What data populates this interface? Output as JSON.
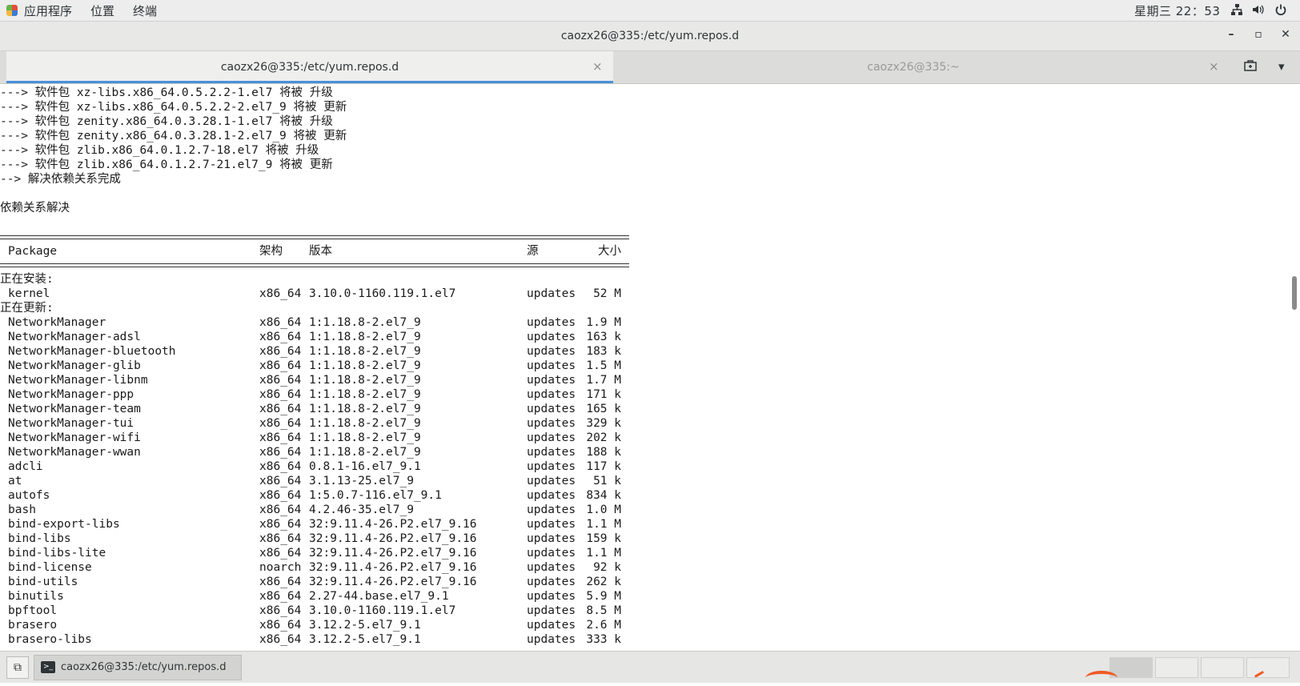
{
  "top_panel": {
    "menus": [
      "应用程序",
      "位置",
      "终端"
    ],
    "clock": "星期三 22：53"
  },
  "window": {
    "title": "caozx26@335:/etc/yum.repos.d"
  },
  "tabs": [
    {
      "label": "caozx26@335:/etc/yum.repos.d",
      "active": true
    },
    {
      "label": "caozx26@335:~",
      "active": false
    }
  ],
  "terminal": {
    "lines": [
      "---> 软件包 xz-libs.x86_64.0.5.2.2-1.el7 将被 升级",
      "---> 软件包 xz-libs.x86_64.0.5.2.2-2.el7_9 将被 更新",
      "---> 软件包 zenity.x86_64.0.3.28.1-1.el7 将被 升级",
      "---> 软件包 zenity.x86_64.0.3.28.1-2.el7_9 将被 更新",
      "---> 软件包 zlib.x86_64.0.1.2.7-18.el7 将被 升级",
      "---> 软件包 zlib.x86_64.0.1.2.7-21.el7_9 将被 更新",
      "--> 解决依赖关系完成",
      "",
      "依赖关系解决"
    ],
    "table_headers": {
      "package": "Package",
      "arch": "架构",
      "version": "版本",
      "source": "源",
      "size": "大小"
    },
    "section_install": "正在安装:",
    "install_rows": [
      {
        "name": "kernel",
        "arch": "x86_64",
        "version": "3.10.0-1160.119.1.el7",
        "source": "updates",
        "size": "52 M"
      }
    ],
    "section_update": "正在更新:",
    "update_rows": [
      {
        "name": "NetworkManager",
        "arch": "x86_64",
        "version": "1:1.18.8-2.el7_9",
        "source": "updates",
        "size": "1.9 M"
      },
      {
        "name": "NetworkManager-adsl",
        "arch": "x86_64",
        "version": "1:1.18.8-2.el7_9",
        "source": "updates",
        "size": "163 k"
      },
      {
        "name": "NetworkManager-bluetooth",
        "arch": "x86_64",
        "version": "1:1.18.8-2.el7_9",
        "source": "updates",
        "size": "183 k"
      },
      {
        "name": "NetworkManager-glib",
        "arch": "x86_64",
        "version": "1:1.18.8-2.el7_9",
        "source": "updates",
        "size": "1.5 M"
      },
      {
        "name": "NetworkManager-libnm",
        "arch": "x86_64",
        "version": "1:1.18.8-2.el7_9",
        "source": "updates",
        "size": "1.7 M"
      },
      {
        "name": "NetworkManager-ppp",
        "arch": "x86_64",
        "version": "1:1.18.8-2.el7_9",
        "source": "updates",
        "size": "171 k"
      },
      {
        "name": "NetworkManager-team",
        "arch": "x86_64",
        "version": "1:1.18.8-2.el7_9",
        "source": "updates",
        "size": "165 k"
      },
      {
        "name": "NetworkManager-tui",
        "arch": "x86_64",
        "version": "1:1.18.8-2.el7_9",
        "source": "updates",
        "size": "329 k"
      },
      {
        "name": "NetworkManager-wifi",
        "arch": "x86_64",
        "version": "1:1.18.8-2.el7_9",
        "source": "updates",
        "size": "202 k"
      },
      {
        "name": "NetworkManager-wwan",
        "arch": "x86_64",
        "version": "1:1.18.8-2.el7_9",
        "source": "updates",
        "size": "188 k"
      },
      {
        "name": "adcli",
        "arch": "x86_64",
        "version": "0.8.1-16.el7_9.1",
        "source": "updates",
        "size": "117 k"
      },
      {
        "name": "at",
        "arch": "x86_64",
        "version": "3.1.13-25.el7_9",
        "source": "updates",
        "size": "51 k"
      },
      {
        "name": "autofs",
        "arch": "x86_64",
        "version": "1:5.0.7-116.el7_9.1",
        "source": "updates",
        "size": "834 k"
      },
      {
        "name": "bash",
        "arch": "x86_64",
        "version": "4.2.46-35.el7_9",
        "source": "updates",
        "size": "1.0 M"
      },
      {
        "name": "bind-export-libs",
        "arch": "x86_64",
        "version": "32:9.11.4-26.P2.el7_9.16",
        "source": "updates",
        "size": "1.1 M"
      },
      {
        "name": "bind-libs",
        "arch": "x86_64",
        "version": "32:9.11.4-26.P2.el7_9.16",
        "source": "updates",
        "size": "159 k"
      },
      {
        "name": "bind-libs-lite",
        "arch": "x86_64",
        "version": "32:9.11.4-26.P2.el7_9.16",
        "source": "updates",
        "size": "1.1 M"
      },
      {
        "name": "bind-license",
        "arch": "noarch",
        "version": "32:9.11.4-26.P2.el7_9.16",
        "source": "updates",
        "size": "92 k"
      },
      {
        "name": "bind-utils",
        "arch": "x86_64",
        "version": "32:9.11.4-26.P2.el7_9.16",
        "source": "updates",
        "size": "262 k"
      },
      {
        "name": "binutils",
        "arch": "x86_64",
        "version": "2.27-44.base.el7_9.1",
        "source": "updates",
        "size": "5.9 M"
      },
      {
        "name": "bpftool",
        "arch": "x86_64",
        "version": "3.10.0-1160.119.1.el7",
        "source": "updates",
        "size": "8.5 M"
      },
      {
        "name": "brasero",
        "arch": "x86_64",
        "version": "3.12.2-5.el7_9.1",
        "source": "updates",
        "size": "2.6 M"
      },
      {
        "name": "brasero-libs",
        "arch": "x86_64",
        "version": "3.12.2-5.el7_9.1",
        "source": "updates",
        "size": "333 k"
      }
    ]
  },
  "taskbar": {
    "task_label": "caozx26@335:/etc/yum.repos.d"
  }
}
